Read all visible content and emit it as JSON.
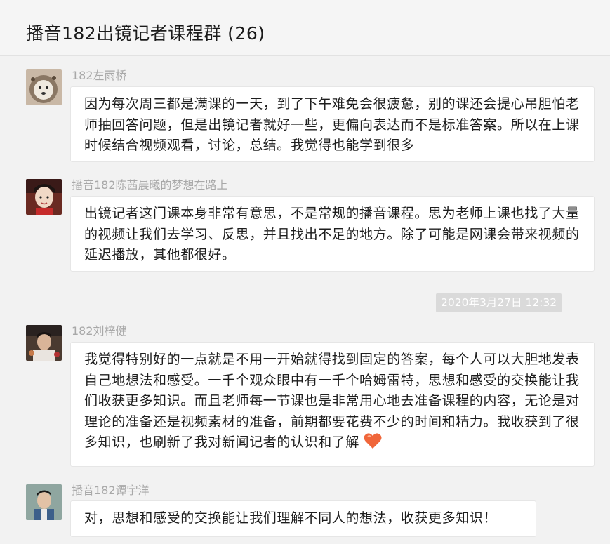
{
  "header": {
    "title": "播音182出镜记者课程群 (26)"
  },
  "messages": [
    {
      "sender": "182左雨桥",
      "text": "因为每次周三都是满课的一天，到了下午难免会很疲惫，别的课还会提心吊胆怕老师抽回答问题，但是出镜记者就好一些，更偏向表达而不是标准答案。所以在上课时候结合视频观看，讨论，总结。我觉得也能学到很多"
    },
    {
      "sender": "播音182陈茜晨曦的梦想在路上",
      "text": "出镜记者这门课本身非常有意思，不是常规的播音课程。思为老师上课也找了大量的视频让我们去学习、反思，并且找出不足的地方。除了可能是网课会带来视频的延迟播放，其他都很好。"
    },
    {
      "sender": "182刘梓健",
      "text": "我觉得特别好的一点就是不用一开始就得找到固定的答案，每个人可以大胆地发表自己地想法和感受。一千个观众眼中有一千个哈姆雷特，思想和感受的交换能让我们收获更多知识。而且老师每一节课也是非常用心地去准备课程的内容，无论是对理论的准备还是视频素材的准备，前期都要花费不少的时间和精力。我收获到了很多知识，也刷新了我对新闻记者的认识和了解"
    },
    {
      "sender": "播音182谭宇洋",
      "text": "对，思想和感受的交换能让我们理解不同人的想法，收获更多知识！"
    }
  ],
  "timestamp": "2020年3月27日 12:32",
  "icons": {
    "heart": "heart-emoji-icon",
    "heart_color": "#f0663a"
  }
}
